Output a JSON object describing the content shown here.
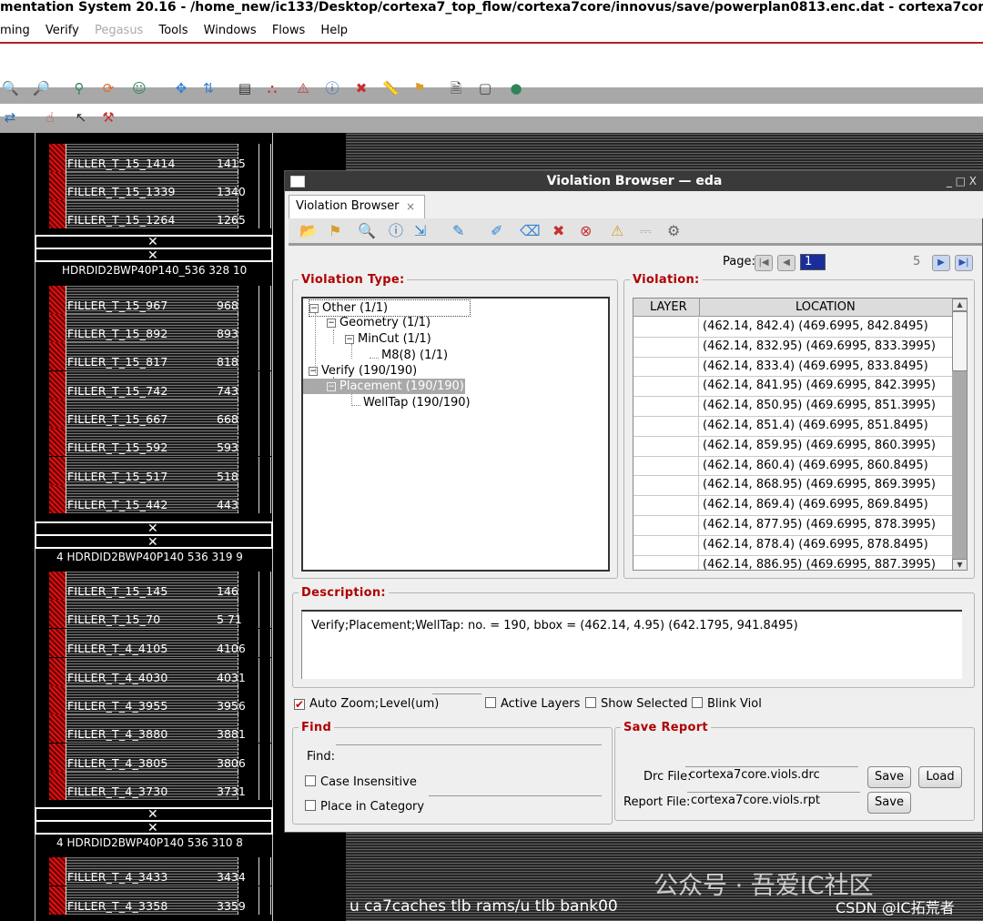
{
  "window": {
    "title": "mentation System 20.16 - /home_new/ic133/Desktop/cortexa7_top_flow/cortexa7core/innovus/save/powerplan0813.enc.dat - cortexa7core"
  },
  "menubar": {
    "items": [
      "ming",
      "Verify",
      "Pegasus",
      "Tools",
      "Windows",
      "Flows",
      "Help"
    ]
  },
  "layout": {
    "filler_rows_top": [
      {
        "name": "FILLER_T_15_1414",
        "num": "1415"
      },
      {
        "name": "FILLER_T_15_1339",
        "num": "1340"
      },
      {
        "name": "FILLER_T_15_1264",
        "num": "1265"
      }
    ],
    "tap1": "HDRDID2BWP40P140_536 328 10",
    "filler_rows_mid": [
      {
        "name": "FILLER_T_15_967",
        "num": "968"
      },
      {
        "name": "FILLER_T_15_892",
        "num": "893"
      },
      {
        "name": "FILLER_T_15_817",
        "num": "818"
      },
      {
        "name": "FILLER_T_15_742",
        "num": "743"
      },
      {
        "name": "FILLER_T_15_667",
        "num": "668"
      },
      {
        "name": "FILLER_T_15_592",
        "num": "593"
      },
      {
        "name": "FILLER_T_15_517",
        "num": "518"
      },
      {
        "name": "FILLER_T_15_442",
        "num": "443"
      }
    ],
    "tap2": "4 HDRDID2BWP40P140 536 319 9",
    "filler_rows_low": [
      {
        "name": "FILLER_T_15_145",
        "num": "146"
      },
      {
        "name": "FILLER_T_15_70",
        "num": "5 71"
      },
      {
        "name": "FILLER_T_4_4105",
        "num": "4106"
      },
      {
        "name": "FILLER_T_4_4030",
        "num": "4031"
      },
      {
        "name": "FILLER_T_4_3955",
        "num": "3956"
      },
      {
        "name": "FILLER_T_4_3880",
        "num": "3881"
      },
      {
        "name": "FILLER_T_4_3805",
        "num": "3806"
      },
      {
        "name": "FILLER_T_4_3730",
        "num": "3731"
      }
    ],
    "tap3": "4 HDRDID2BWP40P140 536 310 8",
    "filler_rows_bottom": [
      {
        "name": "FILLER_T_4_3433",
        "num": "3434"
      },
      {
        "name": "FILLER_T_4_3358",
        "num": "3359"
      }
    ],
    "instance_label": "u ca7caches tlb rams/u tlb bank00",
    "watermark_1": "公众号 · 吾爱IC社区",
    "watermark_2": "CSDN @IC拓荒者"
  },
  "dialog": {
    "title": "Violation Browser — eda",
    "controls": "_ □ X",
    "tab_label": "Violation Browser",
    "tab_close": "×",
    "page_label": "Page:",
    "page_current": "1",
    "page_total": "5",
    "violation_type_legend": "Violation Type:",
    "violation_legend": "Violation:",
    "tree": [
      {
        "label": "Other (1/1)",
        "level": 0,
        "expander": "⊟"
      },
      {
        "label": "Geometry (1/1)",
        "level": 1,
        "expander": "⊟"
      },
      {
        "label": "MinCut (1/1)",
        "level": 2,
        "expander": "⊟"
      },
      {
        "label": "M8(8) (1/1)",
        "level": 3,
        "expander": ""
      },
      {
        "label": "Verify (190/190)",
        "level": 0,
        "expander": "⊟"
      },
      {
        "label": "Placement (190/190)",
        "level": 1,
        "expander": "⊟",
        "selected": true
      },
      {
        "label": "WellTap (190/190)",
        "level": 2,
        "expander": ""
      }
    ],
    "table": {
      "columns": [
        "LAYER",
        "LOCATION"
      ],
      "rows": [
        "(462.14, 842.4) (469.6995, 842.8495)",
        "(462.14, 832.95) (469.6995, 833.3995)",
        "(462.14, 833.4) (469.6995, 833.8495)",
        "(462.14, 841.95) (469.6995, 842.3995)",
        "(462.14, 850.95) (469.6995, 851.3995)",
        "(462.14, 851.4) (469.6995, 851.8495)",
        "(462.14, 859.95) (469.6995, 860.3995)",
        "(462.14, 860.4) (469.6995, 860.8495)",
        "(462.14, 868.95) (469.6995, 869.3995)",
        "(462.14, 869.4) (469.6995, 869.8495)",
        "(462.14, 877.95) (469.6995, 878.3995)",
        "(462.14, 878.4) (469.6995, 878.8495)",
        "(462.14, 886.95) (469.6995, 887.3995)"
      ]
    },
    "description_legend": "Description:",
    "description_text": "Verify;Placement;WellTap: no. = 190, bbox = (462.14, 4.95) (642.1795, 941.8495)",
    "options": {
      "auto_zoom": "Auto Zoom;",
      "auto_zoom_checked": true,
      "level_label": "Level(um)",
      "level_value": "",
      "active_layers": "Active Layers",
      "show_selected": "Show Selected",
      "blink_viol": "Blink Viol"
    },
    "find": {
      "legend": "Find",
      "find_label": "Find:",
      "find_value": "",
      "case_insensitive": "Case Insensitive",
      "place_in_category": "Place in Category",
      "category_value": ""
    },
    "save_report": {
      "legend": "Save Report",
      "drc_label": "Drc File:",
      "drc_value": "cortexa7core.viols.drc",
      "report_label": "Report File:",
      "report_value": "cortexa7core.viols.rpt",
      "save_label": "Save",
      "load_label": "Load"
    }
  }
}
